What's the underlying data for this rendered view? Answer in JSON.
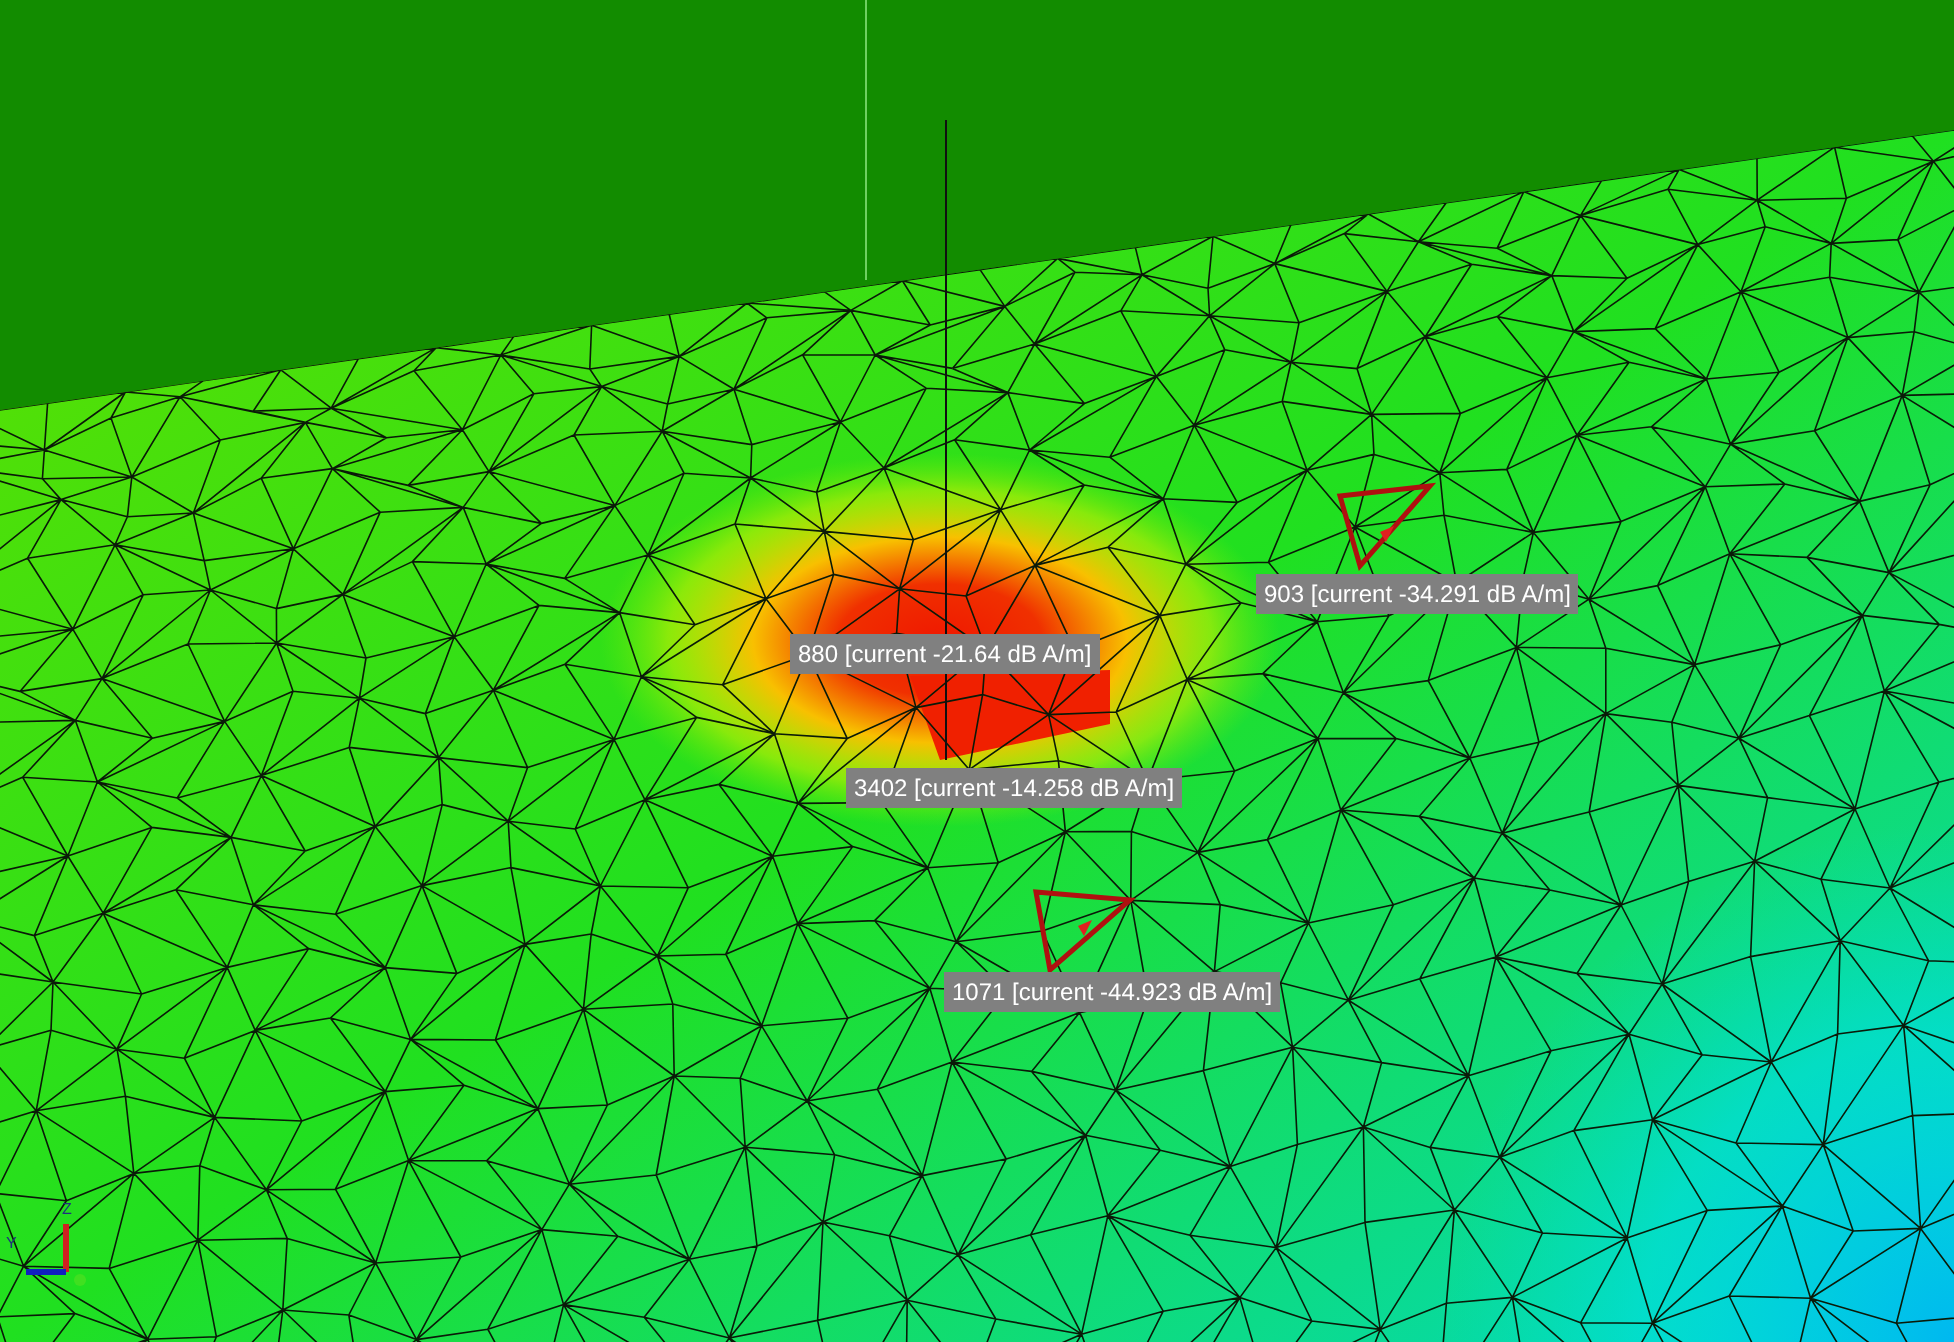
{
  "annotations": [
    {
      "text": "903 [current -34.291 dB A/m]",
      "marker": true
    },
    {
      "text": "880 [current -21.64 dB A/m]",
      "marker": false
    },
    {
      "text": "3402 [current -14.258 dB A/m]",
      "marker": false
    },
    {
      "text": "1071 [current -44.923 dB A/m]",
      "marker": true
    }
  ],
  "axis_labels": [
    "Z",
    "Y"
  ]
}
